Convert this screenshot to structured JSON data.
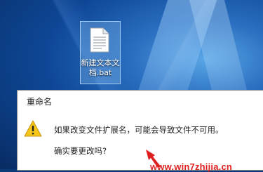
{
  "desktop": {
    "file": {
      "name": "新建文本文档.bat",
      "icon": "text-file-icon"
    }
  },
  "dialog": {
    "title": "重命名",
    "icon": "warning-icon",
    "message": "如果改变文件扩展名，可能会导致文件不可用。",
    "question": "确实要更改吗?"
  },
  "watermark": {
    "text": "www.win7zhijia.cn",
    "color": "#e02020"
  },
  "colors": {
    "warning": "#f5c518",
    "selection": "#99ccff"
  }
}
